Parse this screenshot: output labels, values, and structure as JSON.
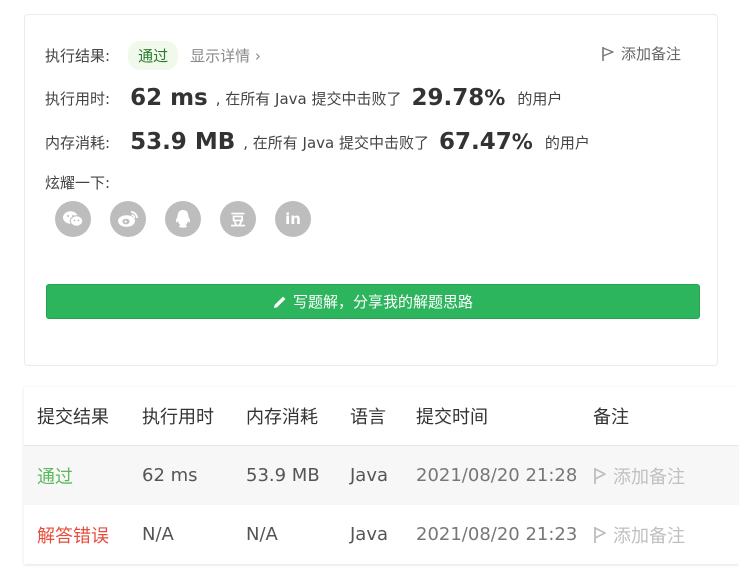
{
  "result": {
    "label": "执行结果:",
    "status": "通过",
    "details": "显示详情 ›",
    "add_note": "添加备注"
  },
  "runtime": {
    "label": "执行用时:",
    "value": "62 ms",
    "middle": ", 在所有 Java 提交中击败了",
    "percent": "29.78",
    "percent_sign": "%",
    "suffix": "的用户"
  },
  "memory": {
    "label": "内存消耗:",
    "value": "53.9 MB",
    "middle": ", 在所有 Java 提交中击败了",
    "percent": "67.47",
    "percent_sign": "%",
    "suffix": "的用户"
  },
  "share": {
    "label": "炫耀一下:",
    "icons": [
      "wechat-icon",
      "weibo-icon",
      "qq-icon",
      "douban-icon",
      "linkedin-icon"
    ],
    "douban_glyph": "豆",
    "linkedin_glyph": "in"
  },
  "write_button": "写题解，分享我的解题思路",
  "colors": {
    "accent_green": "#2db55d",
    "pass_green": "#5cb85c",
    "error_red": "#e74c3c"
  },
  "table": {
    "headers": [
      "提交结果",
      "执行用时",
      "内存消耗",
      "语言",
      "提交时间",
      "备注"
    ],
    "rows": [
      {
        "status": "通过",
        "time": "62 ms",
        "memory": "53.9 MB",
        "lang": "Java",
        "submitted": "2021/08/20 21:28",
        "note": "添加备注"
      },
      {
        "status": "解答错误",
        "time": "N/A",
        "memory": "N/A",
        "lang": "Java",
        "submitted": "2021/08/20 21:23",
        "note": "添加备注"
      }
    ]
  }
}
